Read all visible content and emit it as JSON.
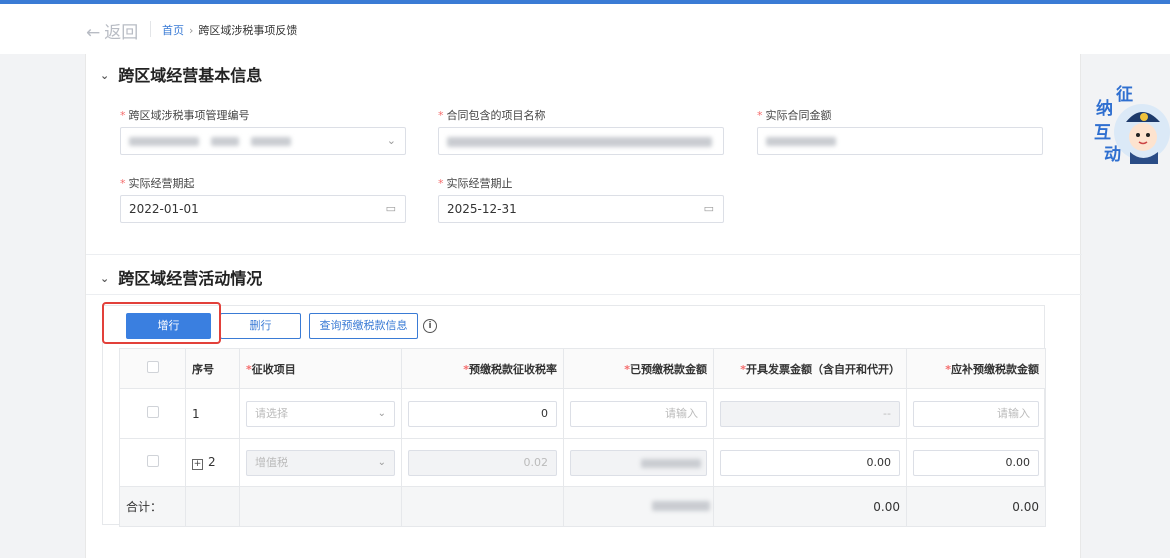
{
  "header": {
    "back_label": "返回",
    "breadcrumb_home": "首页",
    "breadcrumb_current": "跨区域涉税事项反馈"
  },
  "basic_info": {
    "title": "跨区域经营基本信息",
    "fields": {
      "mgmt_no_label": "跨区域涉税事项管理编号",
      "project_name_label": "合同包含的项目名称",
      "contract_amount_label": "实际合同金额",
      "start_label": "实际经营期起",
      "start_value": "2022-01-01",
      "end_label": "实际经营期止",
      "end_value": "2025-12-31"
    }
  },
  "activity": {
    "title": "跨区域经营活动情况",
    "add_row": "增行",
    "delete_row": "删行",
    "query_prepaid": "查询预缴税款信息",
    "columns": {
      "seq": "序号",
      "item": "征收项目",
      "rate": "预缴税款征收税率",
      "prepaid": "已预缴税款金额",
      "invoice": "开具发票金额（含自开和代开）",
      "due": "应补预缴税款金额"
    },
    "rows": [
      {
        "seq": "1",
        "item_ph": "请选择",
        "rate": "0",
        "prepaid_ph": "请输入",
        "invoice": "--",
        "due_ph": "请输入"
      },
      {
        "seq": "2",
        "item": "增值税",
        "rate": "0.02",
        "invoice": "0.00",
        "due": "0.00"
      }
    ],
    "summary": {
      "label": "合计：",
      "invoice": "0.00",
      "due": "0.00"
    }
  },
  "badge": {
    "chars": [
      "征",
      "纳",
      "互",
      "动"
    ]
  },
  "colors": {
    "accent": "#3a7fe0",
    "required": "#f56c6c",
    "highlight": "#e2403a"
  }
}
